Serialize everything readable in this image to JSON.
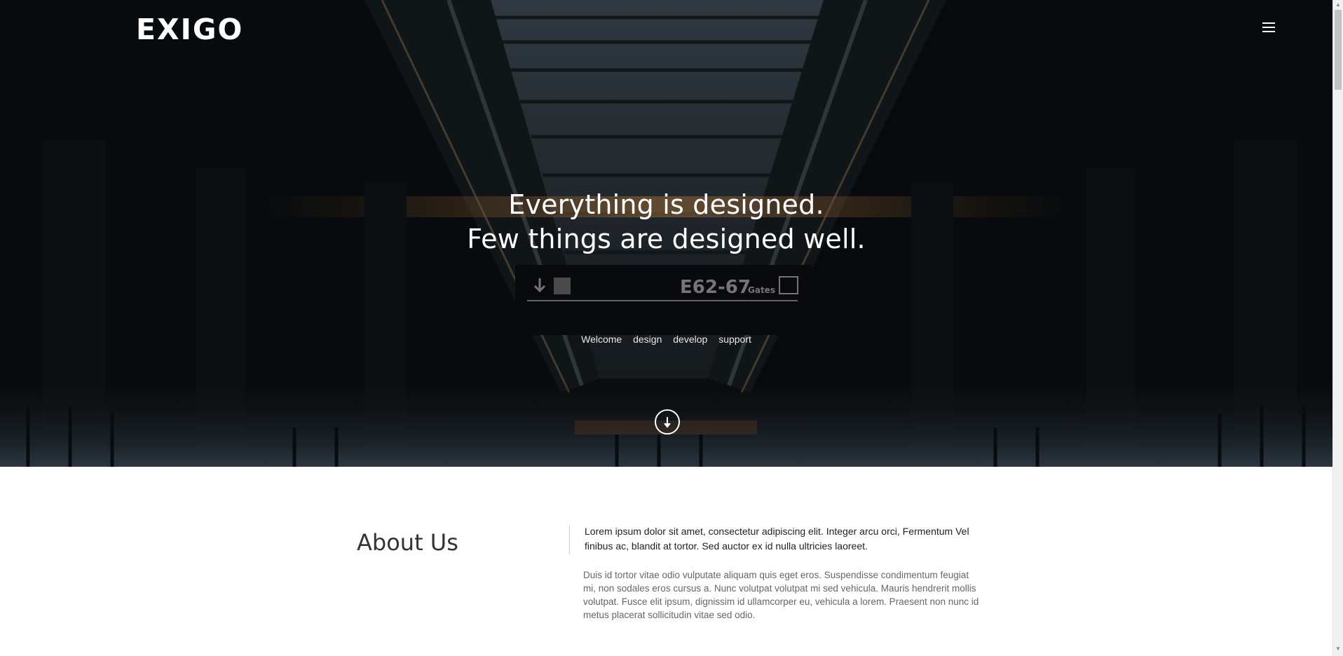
{
  "header": {
    "logo_text": "EXIGO",
    "menu_icon": "hamburger-menu-icon"
  },
  "hero": {
    "headline_line1": "Everything is designed.",
    "headline_line2": "Few things are designed well.",
    "nav": [
      "Welcome",
      "design",
      "develop",
      "support"
    ],
    "scroll_icon": "arrow-down-circle-icon",
    "background_sign_text": "E62-67 Gates"
  },
  "about": {
    "title": "About Us",
    "lead": "Lorem ipsum dolor sit amet, consectetur adipiscing elit. Integer arcu orci, Fermentum Vel finibus ac, blandit at tortor. Sed auctor ex id nulla ultricies laoreet.",
    "body": "Duis id tortor vitae odio vulputate aliquam quis eget eros. Suspendisse condimentum feugiat mi, non sodales eros cursus a. Nunc volutpat volutpat mi sed vehicula. Mauris hendrerit mollis volutpat. Fusce elit ipsum, dignissim id ullamcorper eu, vehicula a lorem. Praesent non nunc id metus placerat sollicitudin vitae sed odio."
  },
  "colors": {
    "hero_dark": "#0b1114",
    "text_white": "#ffffff",
    "heading_gray": "#333333",
    "body_gray": "#666666"
  }
}
